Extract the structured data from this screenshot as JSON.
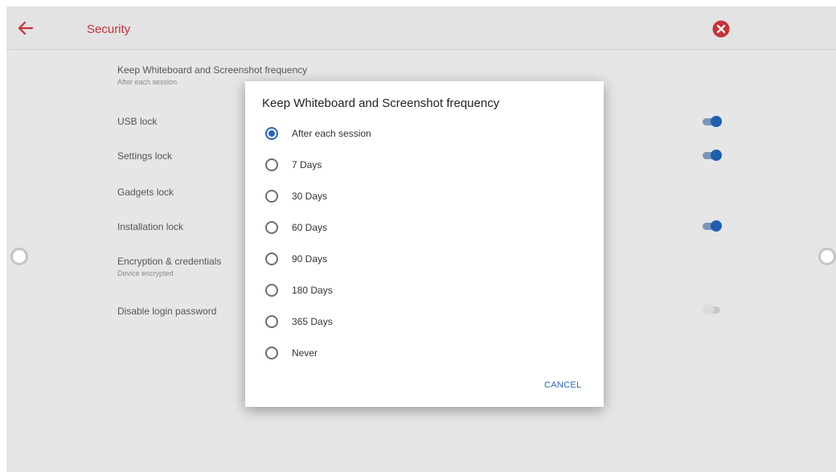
{
  "header": {
    "title": "Security",
    "accent_color": "#c8323a"
  },
  "settings": {
    "items": [
      {
        "label": "Keep Whiteboard and Screenshot frequency",
        "sub": "After each session"
      },
      {
        "label": "USB lock",
        "toggle": "on"
      },
      {
        "label": "Settings lock",
        "toggle": "on"
      },
      {
        "label": "Gadgets lock"
      },
      {
        "label": "Installation lock",
        "toggle": "on"
      },
      {
        "label": "Encryption & credentials",
        "sub": "Device encrypted"
      },
      {
        "label": "Disable login password",
        "toggle": "off"
      }
    ]
  },
  "dialog": {
    "title": "Keep Whiteboard and Screenshot frequency",
    "options": [
      {
        "label": "After each session",
        "selected": true
      },
      {
        "label": "7 Days",
        "selected": false
      },
      {
        "label": "30 Days",
        "selected": false
      },
      {
        "label": "60 Days",
        "selected": false
      },
      {
        "label": "90 Days",
        "selected": false
      },
      {
        "label": "180 Days",
        "selected": false
      },
      {
        "label": "365 Days",
        "selected": false
      },
      {
        "label": "Never",
        "selected": false
      }
    ],
    "cancel_label": "CANCEL",
    "accent_color": "#2a66b8"
  },
  "icons": {
    "back": "arrow-left-icon",
    "close": "close-circle-icon"
  }
}
